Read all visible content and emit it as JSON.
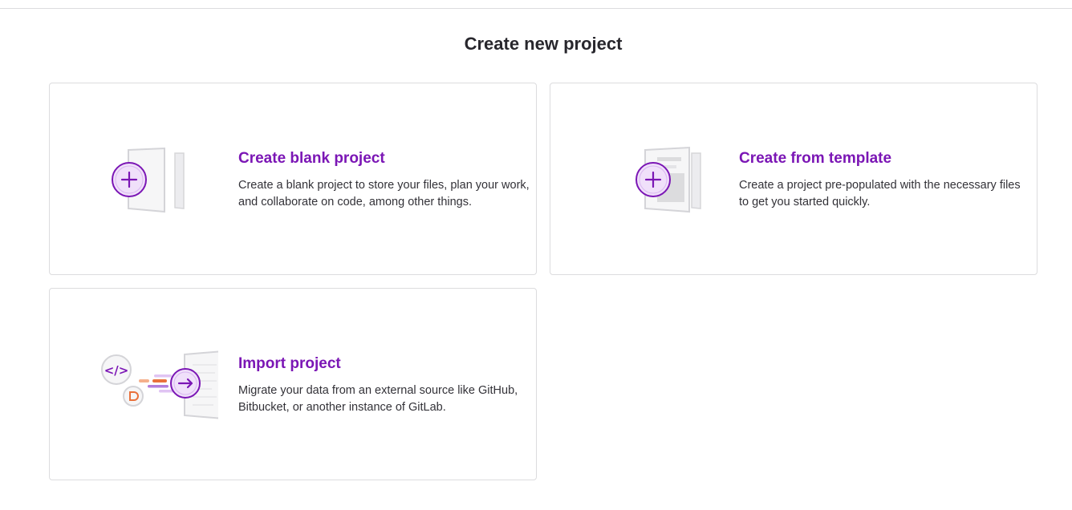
{
  "page": {
    "title": "Create new project"
  },
  "cards": [
    {
      "title": "Create blank project",
      "description": "Create a blank project to store your files, plan your work, and collaborate on code, among other things.",
      "icon": "blank-project-illustration"
    },
    {
      "title": "Create from template",
      "description": "Create a project pre-populated with the necessary files to get you started quickly.",
      "icon": "template-project-illustration"
    },
    {
      "title": "Import project",
      "description": "Migrate your data from an external source like GitHub, Bitbucket, or another instance of GitLab.",
      "icon": "import-project-illustration"
    }
  ],
  "colors": {
    "accent": "#7b16b5",
    "accent_light": "#f0e0fa",
    "border": "#dcdcde",
    "text": "#333238",
    "orange": "#e9713c"
  }
}
